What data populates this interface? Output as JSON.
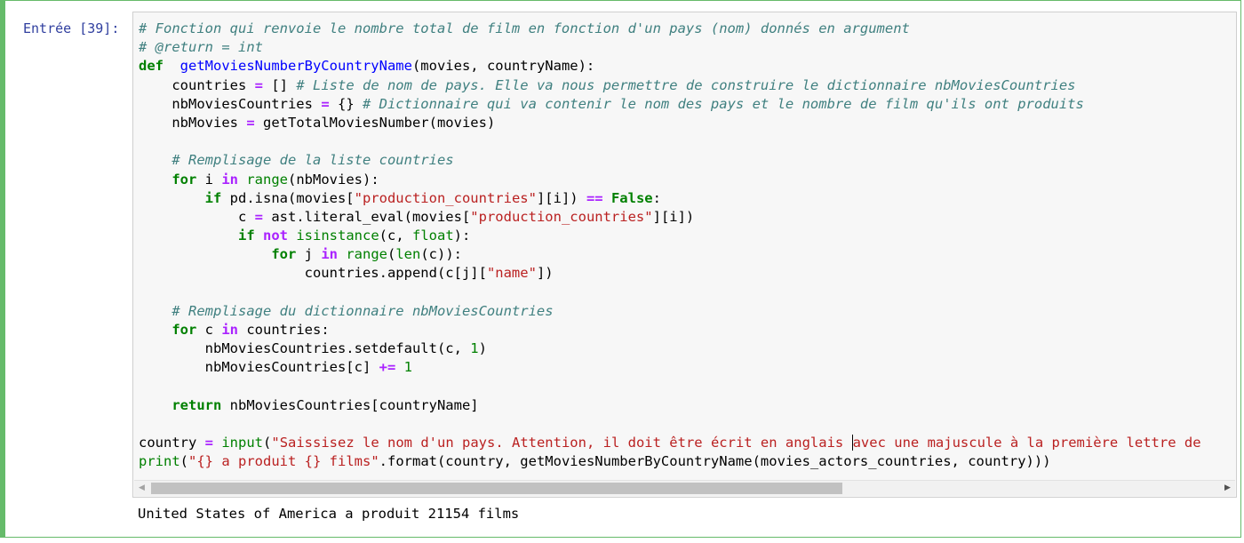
{
  "cell": {
    "prompt": "Entrée [39]:",
    "code_lines": [
      [
        [
          "cm",
          "# Fonction qui renvoie le nombre total de film en fonction d'un pays (nom) donnés en argument"
        ]
      ],
      [
        [
          "cm",
          "# @return = int"
        ]
      ],
      [
        [
          "kw",
          "def"
        ],
        [
          "",
          "  "
        ],
        [
          "fn",
          "getMoviesNumberByCountryName"
        ],
        [
          "",
          "(movies, countryName):"
        ]
      ],
      [
        [
          "",
          "    countries "
        ],
        [
          "op",
          "="
        ],
        [
          "",
          " [] "
        ],
        [
          "cm",
          "# Liste de nom de pays. Elle va nous permettre de construire le dictionnaire nbMoviesCountries"
        ]
      ],
      [
        [
          "",
          "    nbMoviesCountries "
        ],
        [
          "op",
          "="
        ],
        [
          "",
          " {} "
        ],
        [
          "cm",
          "# Dictionnaire qui va contenir le nom des pays et le nombre de film qu'ils ont produits"
        ]
      ],
      [
        [
          "",
          "    nbMovies "
        ],
        [
          "op",
          "="
        ],
        [
          "",
          " getTotalMoviesNumber(movies)"
        ]
      ],
      [],
      [
        [
          "",
          "    "
        ],
        [
          "cm",
          "# Remplisage de la liste countries"
        ]
      ],
      [
        [
          "",
          "    "
        ],
        [
          "kw",
          "for"
        ],
        [
          "",
          " i "
        ],
        [
          "op",
          "in"
        ],
        [
          "",
          " "
        ],
        [
          "bi",
          "range"
        ],
        [
          "",
          "(nbMovies):"
        ]
      ],
      [
        [
          "",
          "        "
        ],
        [
          "kw",
          "if"
        ],
        [
          "",
          " pd.isna(movies["
        ],
        [
          "st",
          "\"production_countries\""
        ],
        [
          "",
          "][i]) "
        ],
        [
          "op",
          "=="
        ],
        [
          "",
          " "
        ],
        [
          "kw",
          "False"
        ],
        [
          "",
          ":"
        ]
      ],
      [
        [
          "",
          "            c "
        ],
        [
          "op",
          "="
        ],
        [
          "",
          " ast.literal_eval(movies["
        ],
        [
          "st",
          "\"production_countries\""
        ],
        [
          "",
          "][i])"
        ]
      ],
      [
        [
          "",
          "            "
        ],
        [
          "kw",
          "if"
        ],
        [
          "",
          " "
        ],
        [
          "op",
          "not"
        ],
        [
          "",
          " "
        ],
        [
          "bi",
          "isinstance"
        ],
        [
          "",
          "(c, "
        ],
        [
          "bi",
          "float"
        ],
        [
          "",
          "):"
        ]
      ],
      [
        [
          "",
          "                "
        ],
        [
          "kw",
          "for"
        ],
        [
          "",
          " j "
        ],
        [
          "op",
          "in"
        ],
        [
          "",
          " "
        ],
        [
          "bi",
          "range"
        ],
        [
          "",
          "("
        ],
        [
          "bi",
          "len"
        ],
        [
          "",
          "(c)):"
        ]
      ],
      [
        [
          "",
          "                    countries.append(c[j]["
        ],
        [
          "st",
          "\"name\""
        ],
        [
          "",
          "])"
        ]
      ],
      [],
      [
        [
          "",
          "    "
        ],
        [
          "cm",
          "# Remplisage du dictionnaire nbMoviesCountries"
        ]
      ],
      [
        [
          "",
          "    "
        ],
        [
          "kw",
          "for"
        ],
        [
          "",
          " c "
        ],
        [
          "op",
          "in"
        ],
        [
          "",
          " countries:"
        ]
      ],
      [
        [
          "",
          "        nbMoviesCountries.setdefault(c, "
        ],
        [
          "nu",
          "1"
        ],
        [
          "",
          ")"
        ]
      ],
      [
        [
          "",
          "        nbMoviesCountries[c] "
        ],
        [
          "op",
          "+="
        ],
        [
          "",
          " "
        ],
        [
          "nu",
          "1"
        ]
      ],
      [],
      [
        [
          "",
          "    "
        ],
        [
          "kw",
          "return"
        ],
        [
          "",
          " nbMoviesCountries[countryName]"
        ]
      ],
      [],
      [
        [
          "",
          "country "
        ],
        [
          "op",
          "="
        ],
        [
          "",
          " "
        ],
        [
          "bi",
          "input"
        ],
        [
          "",
          "("
        ],
        [
          "st",
          "\"Saissisez le nom d'un pays. Attention, il doit être écrit en anglais "
        ],
        [
          "caret",
          ""
        ],
        [
          "st",
          "avec une majuscule à la première lettre de"
        ]
      ],
      [
        [
          "bi",
          "print"
        ],
        [
          "",
          "("
        ],
        [
          "st",
          "\"{} a produit {} films\""
        ],
        [
          "",
          ".format(country, getMoviesNumberByCountryName(movies_actors_countries, country)))"
        ]
      ]
    ],
    "output": "United States of America a produit 21154 films",
    "scrollbar": {
      "left_arrow": "◀",
      "right_arrow": "▶",
      "thumb_fraction": 0.64
    }
  },
  "colors": {
    "cell_border": "#66bb6a",
    "prompt": "#303f9f",
    "comment": "#408080",
    "keyword": "#008000",
    "string": "#ba2121",
    "operator": "#aa22ff",
    "function_name": "#0000ff"
  }
}
